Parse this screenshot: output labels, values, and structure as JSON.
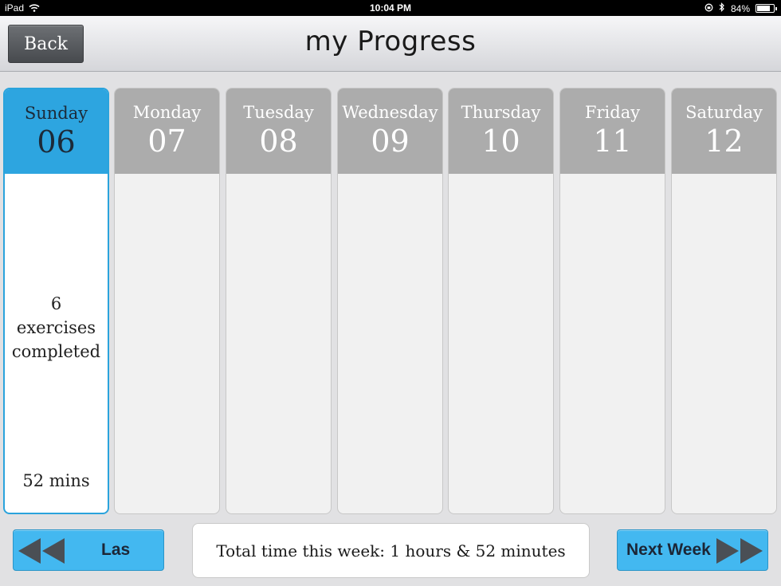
{
  "status_bar": {
    "device": "iPad",
    "time": "10:04 PM",
    "battery": "84%",
    "battery_level": 0.84,
    "icons": [
      "wifi-icon",
      "lock-rotation-icon",
      "bluetooth-icon",
      "battery-icon"
    ]
  },
  "nav": {
    "back_label": "Back",
    "title": "my Progress"
  },
  "days": [
    {
      "name": "Sunday",
      "number": "06",
      "active": true,
      "summary_count": "6",
      "summary_line1": "exercises",
      "summary_line2": "completed",
      "mins": "52 mins"
    },
    {
      "name": "Monday",
      "number": "07",
      "active": false
    },
    {
      "name": "Tuesday",
      "number": "08",
      "active": false
    },
    {
      "name": "Wednesday",
      "number": "09",
      "active": false
    },
    {
      "name": "Thursday",
      "number": "10",
      "active": false
    },
    {
      "name": "Friday",
      "number": "11",
      "active": false
    },
    {
      "name": "Saturday",
      "number": "12",
      "active": false
    }
  ],
  "footer": {
    "last_week_label": "Las",
    "total_text": "Total time this week: 1 hours & 52 minutes",
    "next_week_label": "Next Week"
  },
  "colors": {
    "active_header": "#2da5e0",
    "inactive_header": "#acacac",
    "button_blue": "#43b8f0",
    "back_button": "#55585c"
  }
}
